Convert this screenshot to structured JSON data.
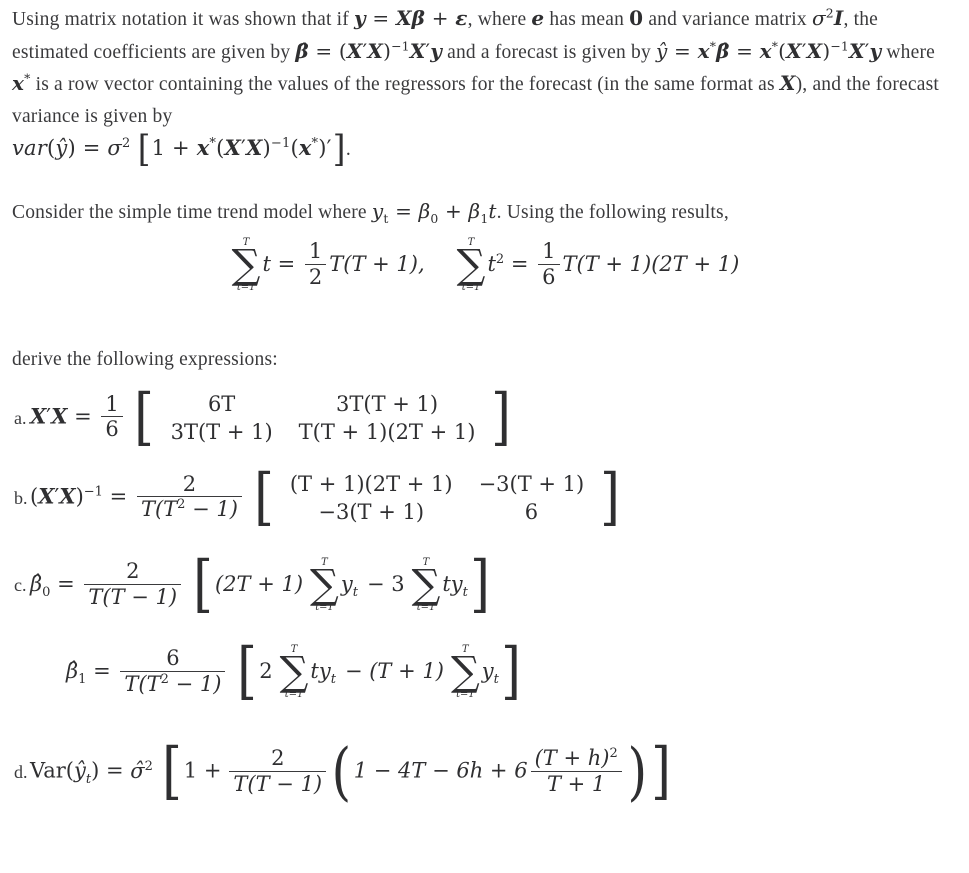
{
  "document": {
    "type": "textbook-problem",
    "background_color": "#ffffff",
    "text_color": "#3a3a3c",
    "math_color": "#2f2f31"
  },
  "paragraphs": {
    "intro": {
      "s1": "Using matrix notation it was shown that if ",
      "s2": ", where ",
      "s3": " has mean ",
      "s4": " and variance matrix ",
      "s5": ", the estimated coefficients are given by ",
      "s6": " and a forecast is given by ",
      "s7": " where ",
      "s8": " is a row vector containing the values of the regressors for the forecast (in the same format as ",
      "s9": "), and the forecast variance is given by ",
      "s10": "."
    },
    "consider": {
      "s1": "Consider the simple time trend model where ",
      "s2": ". Using the following results,"
    },
    "derive": {
      "s1": "derive the following expressions:"
    }
  },
  "math": {
    "y": "y",
    "X": "X",
    "beta": "β",
    "epsilon": "ε",
    "e": "e",
    "zero": "0",
    "sigma": "σ",
    "I": "I",
    "betahat": "β̂",
    "yhat": "ŷ",
    "xstar": "x",
    "star": "*",
    "var": "var",
    "Var": "Var",
    "T": "T",
    "t": "t",
    "h": "h",
    "one": "1",
    "two": "2",
    "three": "3",
    "six": "6",
    "four": "4",
    "eq": "=",
    "plus": "+",
    "minus": "−",
    "prime": "′",
    "inv": "−1",
    "sum": "∑",
    "tlower": "t=1",
    "Tupper": "T"
  },
  "equations": {
    "sums": {
      "left": {
        "upper": "T",
        "lower": "t=1",
        "summand": "t",
        "rhs_num": "1",
        "rhs_den": "2",
        "rhs_rest": "T(T + 1),"
      },
      "right": {
        "upper": "T",
        "lower": "t=1",
        "summand": "t",
        "summand_exp": "2",
        "rhs_num": "1",
        "rhs_den": "6",
        "rhs_rest": "T(T + 1)(2T + 1)"
      }
    },
    "items": [
      {
        "label": "a.",
        "lhs": "X′X",
        "scalar_num": "1",
        "scalar_den": "6",
        "matrix": [
          [
            "6T",
            "3T(T + 1)"
          ],
          [
            "3T(T + 1)",
            "T(T + 1)(2T + 1)"
          ]
        ]
      },
      {
        "label": "b.",
        "lhs": "(X′X)",
        "lhs_exp": "−1",
        "scalar_num": "2",
        "scalar_den": "T(T² − 1)",
        "matrix": [
          [
            "(T + 1)(2T + 1)",
            "−3(T + 1)"
          ],
          [
            "−3(T + 1)",
            "6"
          ]
        ]
      },
      {
        "label": "c.",
        "lhs": "β̂₀",
        "scalar_num": "2",
        "scalar_den": "T(T − 1)",
        "body_prefix": "(2T + 1)",
        "sum1_summand": "y",
        "sum1_sub": "t",
        "middle_op": "− 3",
        "sum2_summand": "ty",
        "sum2_sub": "t",
        "sum_upper": "T",
        "sum_lower": "t=1"
      },
      {
        "label": "",
        "lhs": "β̂₁",
        "scalar_num": "6",
        "scalar_den": "T(T² − 1)",
        "body_prefix": "2",
        "sum1_summand": "ty",
        "sum1_sub": "t",
        "middle_op": "− (T + 1)",
        "sum2_summand": "y",
        "sum2_sub": "t",
        "sum_upper": "T",
        "sum_lower": "t=1"
      },
      {
        "label": "d.",
        "lhs": "Var(ŷt)",
        "sigma_hat": "σ̂",
        "sigma_exp": "2",
        "one": "1 +",
        "scalar_num": "2",
        "scalar_den": "T(T − 1)",
        "inner_prefix": "1 − 4T − 6h + 6",
        "inner_frac_num": "(T + h)²",
        "inner_frac_den": "T + 1"
      }
    ]
  }
}
